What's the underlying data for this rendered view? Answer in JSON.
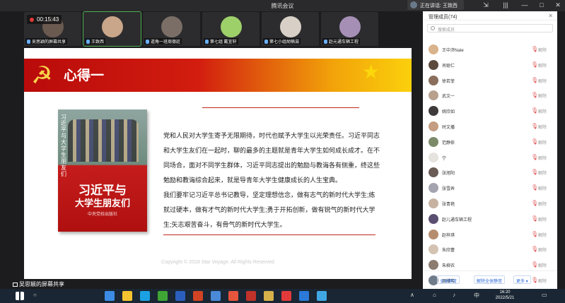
{
  "titlebar": {
    "title": "腾讯会议",
    "speaker_label": "正在讲话: 王致西"
  },
  "recording": {
    "time": "00:15:43"
  },
  "participants_strip": [
    {
      "name": "吴思颖的屏幕共享",
      "face_color": "#6b5a50"
    },
    {
      "name": "王致西",
      "face_color": "#c9a58a"
    },
    {
      "name": "道角一班周德廷",
      "face_color": "#7a6e66"
    },
    {
      "name": "第七组 戴宜轩",
      "face_color": "#9ed06a"
    },
    {
      "name": "第七小组胡楠滋",
      "face_color": "#d8d0c6"
    },
    {
      "name": "赵元通车辆工程",
      "face_color": "#a58fb5"
    }
  ],
  "slide": {
    "heading": "心得一",
    "emblem": "☭",
    "star": "★",
    "book": {
      "vertical_title": "习近平与大学生朋友们",
      "title_line1": "习近平与",
      "title_line2": "大学生朋友们",
      "publisher": "中央党校出版社"
    },
    "paragraphs": [
      "党和人民对大学生寄予无限期待，时代也赋予大学生以光荣责任。习近平同志和大学生友们在一起时，聊的最多的主题就是青年大学生如何成长成才。在不同场合，面对不同学生群体，习近平同志提出的勉励与教诲各有侧重，终这些勉励和教诲综合起来，就是导青年大学生健康成长的人生宝典。",
      "我们要牢记习近平总书记教导，坚定理想信念，做有志气的新时代大学生;练就过硬本，做有才气的新时代大学生;勇于开拓创新，做有锐气的新时代大学生;矢志艰苦奋斗，有骨气的新时代大学生。"
    ],
    "copyright": "Copyright © 2018 Star Voyage. All Rights Reserved"
  },
  "share_caption": "吴思颖的屏幕共享",
  "panel": {
    "header": "管理成员(74)",
    "search_placeholder": "搜索成员",
    "mute_label": "解除",
    "members": [
      {
        "name": "王中济Nate",
        "color": "#d9b38c"
      },
      {
        "name": "肖聪仁",
        "color": "#5d4a3e"
      },
      {
        "name": "徐若菲",
        "color": "#8a6f5c"
      },
      {
        "name": "武文一",
        "color": "#b8a08f"
      },
      {
        "name": "姚欣如",
        "color": "#3e3a3a"
      },
      {
        "name": "时文播",
        "color": "#c49d82"
      },
      {
        "name": "范静依",
        "color": "#7d8a6a"
      },
      {
        "name": "宁",
        "color": "#e6e2dd"
      },
      {
        "name": "张旭阳",
        "color": "#6a5b55"
      },
      {
        "name": "张雪弄",
        "color": "#a4a4b0"
      },
      {
        "name": "张青艳",
        "color": "#c7b2a2"
      },
      {
        "name": "赵儿通车辆工程",
        "color": "#5a4f70"
      },
      {
        "name": "赵梓琪",
        "color": "#b58d6e"
      },
      {
        "name": "朱欣蕾",
        "color": "#d4c3b2"
      },
      {
        "name": "朱柳衣",
        "color": "#8c7c70"
      },
      {
        "name": "周维韦",
        "color": "#6f7c8a"
      }
    ],
    "buttons": {
      "mute_all": "全体静音",
      "unmute_all": "解除全体静音",
      "more": "更多"
    }
  },
  "taskbar": {
    "time": "16:20",
    "date": "2022/5/21",
    "lang": "中",
    "apps": [
      "#3c8ce6",
      "#f4c430",
      "#1ba1e2",
      "#3fa535",
      "#2b5fbf",
      "#d04423",
      "#4a8ad8",
      "#e7553d",
      "#c0322a",
      "#d7b24a",
      "#e23a3a",
      "#2b7ad8",
      "#40a7e3"
    ]
  }
}
